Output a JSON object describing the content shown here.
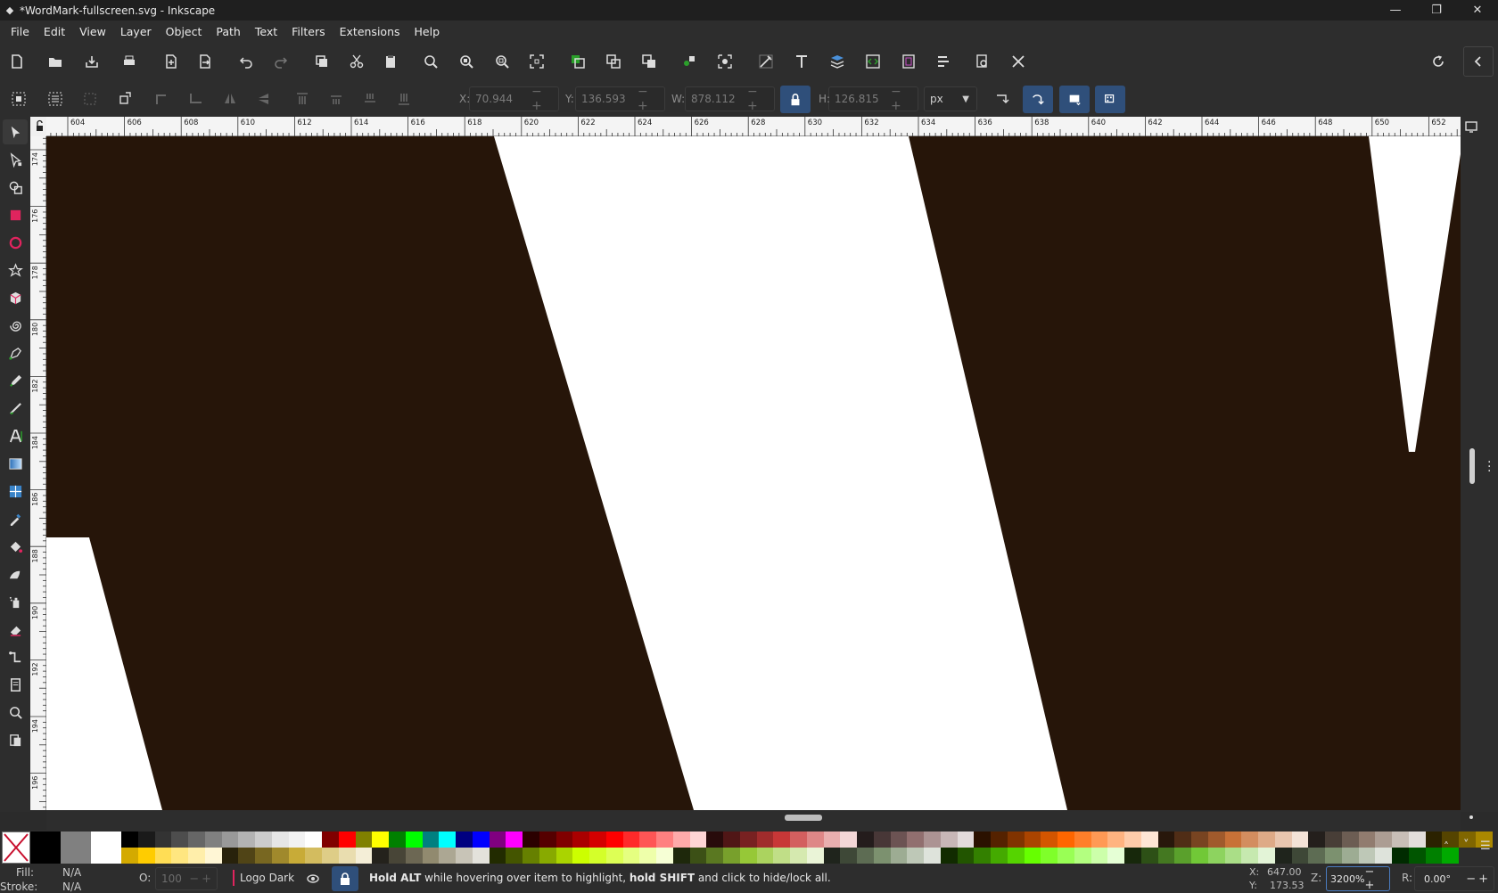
{
  "window": {
    "title": "*WordMark-fullscreen.svg - Inkscape",
    "minimize": "—",
    "maximize": "❐",
    "close": "✕"
  },
  "menu": [
    "File",
    "Edit",
    "View",
    "Layer",
    "Object",
    "Path",
    "Text",
    "Filters",
    "Extensions",
    "Help"
  ],
  "commands": [
    {
      "name": "new-document-icon"
    },
    {
      "name": "open-file-icon"
    },
    {
      "name": "save-icon"
    },
    {
      "name": "print-icon"
    },
    {
      "name": "import-icon"
    },
    {
      "name": "export-icon"
    },
    {
      "name": "undo-icon"
    },
    {
      "name": "redo-icon"
    },
    {
      "name": "copy-icon"
    },
    {
      "name": "cut-icon"
    },
    {
      "name": "paste-icon"
    },
    {
      "name": "zoom-selection-icon"
    },
    {
      "name": "zoom-drawing-icon"
    },
    {
      "name": "zoom-page-icon"
    },
    {
      "name": "zoom-center-icon"
    },
    {
      "name": "duplicate-icon"
    },
    {
      "name": "clone-icon"
    },
    {
      "name": "unlink-clone-icon"
    },
    {
      "name": "group-icon"
    },
    {
      "name": "ungroup-icon"
    },
    {
      "name": "fill-stroke-icon"
    },
    {
      "name": "text-font-icon"
    },
    {
      "name": "layers-icon"
    },
    {
      "name": "xml-editor-icon"
    },
    {
      "name": "document-properties-icon"
    },
    {
      "name": "align-distribute-icon"
    },
    {
      "name": "find-replace-icon"
    },
    {
      "name": "preferences-icon"
    }
  ],
  "select_toolbar": {
    "x_label": "X:",
    "x_value": "70.944",
    "y_label": "Y:",
    "y_value": "136.593",
    "w_label": "W:",
    "w_value": "878.112",
    "h_label": "H:",
    "h_value": "126.815",
    "unit": "px"
  },
  "tools": [
    "selector-tool-icon",
    "node-tool-icon",
    "shape-builder-icon",
    "rectangle-tool-icon",
    "ellipse-tool-icon",
    "star-tool-icon",
    "3d-box-tool-icon",
    "spiral-tool-icon",
    "pen-tool-icon",
    "pencil-tool-icon",
    "calligraphy-tool-icon",
    "text-tool-icon",
    "gradient-tool-icon",
    "mesh-tool-icon",
    "dropper-tool-icon",
    "paint-bucket-icon",
    "tweak-tool-icon",
    "spray-tool-icon",
    "eraser-tool-icon",
    "connector-tool-icon",
    "pages-tool-icon",
    "zoom-tool-icon",
    "measure-tool-icon"
  ],
  "ruler": {
    "h_ticks": [
      "604",
      "606",
      "608",
      "610",
      "612",
      "614",
      "616",
      "618",
      "620",
      "622",
      "624",
      "626",
      "628",
      "630",
      "632",
      "634",
      "636",
      "638",
      "640",
      "642",
      "644",
      "646",
      "648",
      "650",
      "652"
    ],
    "v_ticks": [
      "174",
      "176",
      "178",
      "180",
      "182",
      "184",
      "186",
      "188",
      "190",
      "192",
      "194",
      "196"
    ]
  },
  "canvas": {
    "fill_dark": "#261509",
    "fill_light": "#ffffff"
  },
  "palette": {
    "row1": [
      "#000000",
      "#1a1a1a",
      "#333333",
      "#4d4d4d",
      "#666666",
      "#808080",
      "#999999",
      "#b3b3b3",
      "#cccccc",
      "#e6e6e6",
      "#f2f2f2",
      "#ffffff",
      "#800000",
      "#ff0000",
      "#808000",
      "#ffff00",
      "#008000",
      "#00ff00",
      "#008080",
      "#00ffff",
      "#000080",
      "#0000ff",
      "#800080",
      "#ff00ff",
      "#2b0000",
      "#550000",
      "#800000",
      "#aa0000",
      "#d40000",
      "#ff0000",
      "#ff2a2a",
      "#ff5555",
      "#ff8080",
      "#ffaaaa",
      "#ffd5d5",
      "#280b0b",
      "#501616",
      "#782121",
      "#a02c2c",
      "#c83737",
      "#d35f5f",
      "#de8787",
      "#e9afaf",
      "#f4d7d7",
      "#241c1c",
      "#483737",
      "#6c5353",
      "#916f6f",
      "#ac9393",
      "#c8b7b7",
      "#e3dbdb",
      "#2b1100",
      "#552200",
      "#803300",
      "#aa4400",
      "#d45500",
      "#ff6600",
      "#ff7f2a",
      "#ff9955",
      "#ffb380",
      "#ffccaa",
      "#ffe6d5",
      "#28170b",
      "#502d16",
      "#784421",
      "#a05a2c",
      "#c87137",
      "#d38d5f",
      "#deaa87",
      "#e9c6af",
      "#f4e3d7",
      "#241f1c",
      "#483e37",
      "#6c5d53",
      "#917c6f",
      "#ac9d93",
      "#c8beb7",
      "#e3dedb",
      "#2b2200",
      "#554400",
      "#806600",
      "#aa8800"
    ],
    "row2": [
      "#d4aa00",
      "#ffcc00",
      "#ffdd55",
      "#ffe680",
      "#ffeeaa",
      "#fff6d5",
      "#28220b",
      "#504416",
      "#786721",
      "#a0892c",
      "#c8ab37",
      "#d3bc5f",
      "#decd87",
      "#e9ddaf",
      "#f4eed7",
      "#24221c",
      "#484537",
      "#6c6753",
      "#918a6f",
      "#aca793",
      "#c8c4b7",
      "#e3e2db",
      "#222b00",
      "#445500",
      "#668000",
      "#88aa00",
      "#aad400",
      "#ccff00",
      "#d4ff2a",
      "#ddff55",
      "#e5ff80",
      "#eeffaa",
      "#f6ffd5",
      "#1e280b",
      "#3c5016",
      "#5a7821",
      "#78a02c",
      "#96c837",
      "#abd35f",
      "#c0de87",
      "#d5e9af",
      "#eaf4d7",
      "#1f241c",
      "#3e4837",
      "#5d6c53",
      "#7c916f",
      "#9dac93",
      "#bec8b7",
      "#dee3db",
      "#112b00",
      "#225500",
      "#338000",
      "#44aa00",
      "#55d400",
      "#66ff00",
      "#7fff2a",
      "#99ff55",
      "#b3ff80",
      "#ccffaa",
      "#e5ffd5",
      "#17280b",
      "#2d5016",
      "#447821",
      "#5aa02c",
      "#71c837",
      "#8dd35f",
      "#aade87",
      "#c6e9af",
      "#e3f4d7",
      "#1f241c",
      "#3e4837",
      "#5d6c53",
      "#7c916f",
      "#9dac93",
      "#bec8b7",
      "#dee3db",
      "#002b00",
      "#005500",
      "#008000",
      "#00aa00"
    ]
  },
  "status": {
    "fill_label": "Fill:",
    "fill_value": "N/A",
    "stroke_label": "Stroke:",
    "stroke_value": "N/A",
    "opacity_label": "O:",
    "opacity_value": "100",
    "layer_name": "Logo Dark",
    "hint_bold1": "Hold ALT",
    "hint_mid": " while hovering over item to highlight, ",
    "hint_bold2": "hold SHIFT",
    "hint_end": " and click to hide/lock all.",
    "cursor_x_label": "X:",
    "cursor_x": "647.00",
    "cursor_y_label": "Y:",
    "cursor_y": "173.53",
    "zoom_label": "Z:",
    "zoom_value": "3200%",
    "rotation_label": "R:",
    "rotation_value": "0.00°"
  }
}
